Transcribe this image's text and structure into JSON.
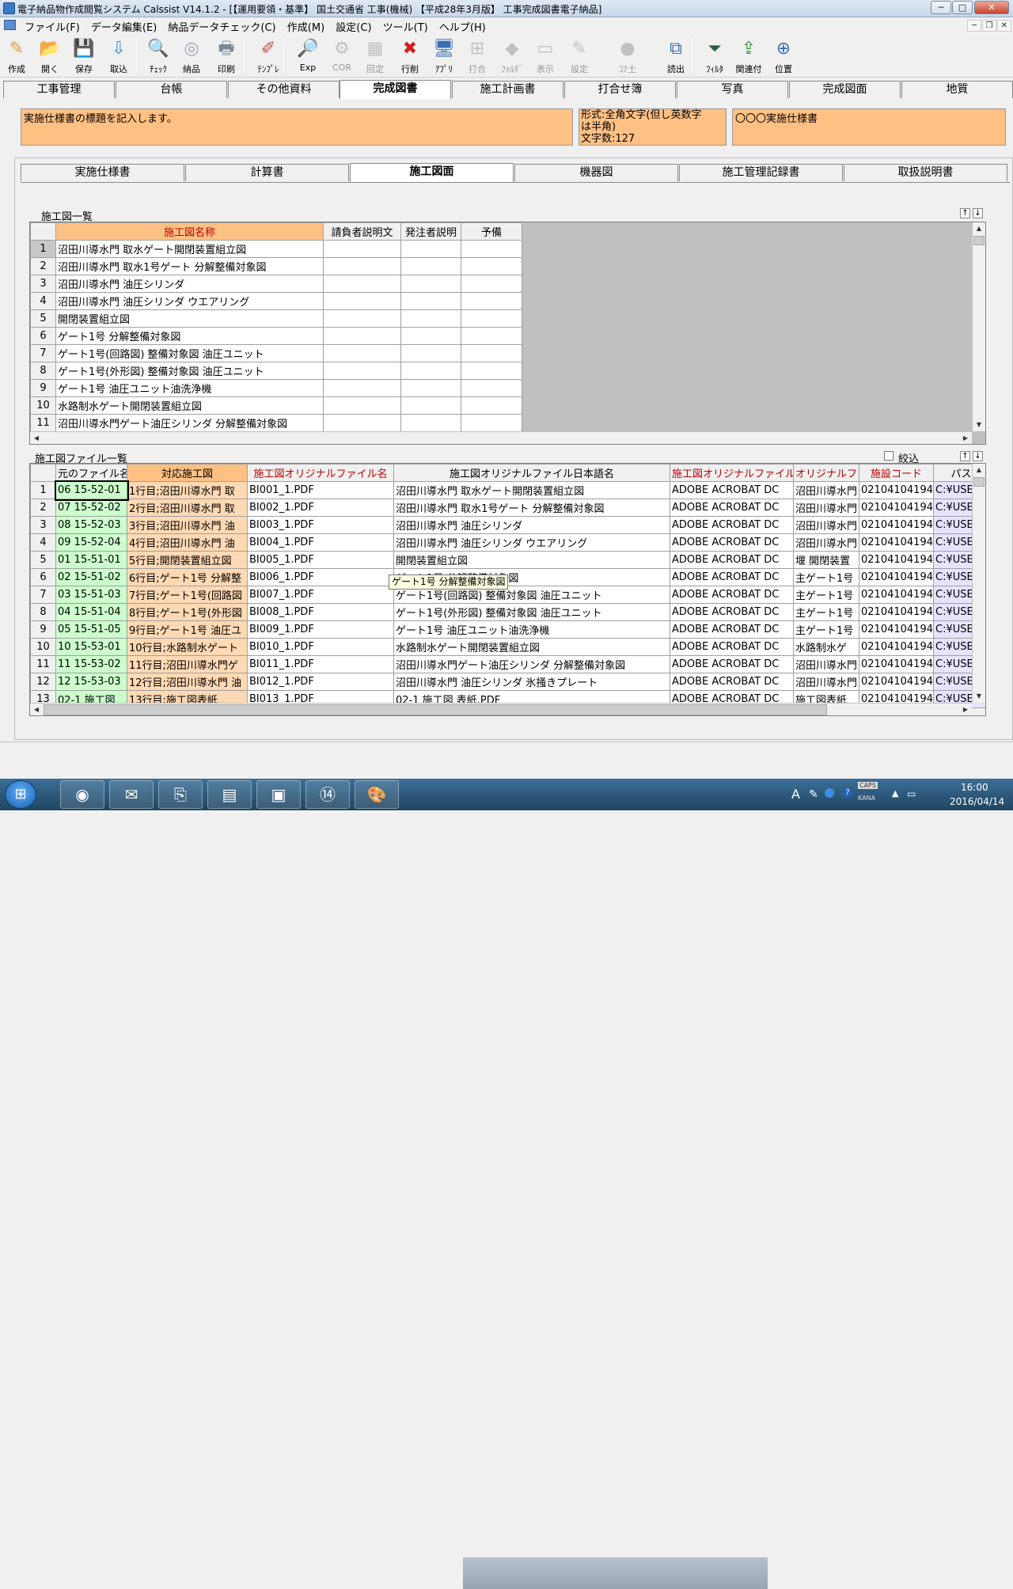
{
  "window": {
    "title": "電子納品物作成閲覧システム Calssist V14.1.2 - [【運用要領・基準】 国土交通省 工事(機械) 【平成28年3月版】 工事完成図書電子納品]",
    "minimize": "─",
    "maximize": "□",
    "close": "✕"
  },
  "menubar": {
    "items": [
      "ファイル(F)",
      "データ編集(E)",
      "納品データチェック(C)",
      "作成(M)",
      "設定(C)",
      "ツール(T)",
      "ヘルプ(H)"
    ],
    "mdi_min": "─",
    "mdi_restore": "❐",
    "mdi_close": "✕"
  },
  "toolbar": {
    "buttons": [
      {
        "label": "作成",
        "icon": "create-icon",
        "glyph": "✎",
        "color": "#d9a441"
      },
      {
        "label": "開く",
        "icon": "open-folder-icon",
        "glyph": "📂",
        "color": "#f4c64d"
      },
      {
        "label": "保存",
        "icon": "save-icon",
        "glyph": "💾",
        "color": "#2a3f7a"
      },
      {
        "label": "取込",
        "icon": "import-icon",
        "glyph": "⇩",
        "color": "#3c8fd6"
      },
      {
        "label": "ﾁｪｯｸ",
        "icon": "check-icon",
        "glyph": "🔍",
        "color": "#6aa8e0"
      },
      {
        "label": "納品",
        "icon": "disc-icon",
        "glyph": "◎",
        "color": "#9aa7b8"
      },
      {
        "label": "印刷",
        "icon": "print-icon",
        "glyph": "🖶",
        "color": "#7d8794"
      },
      {
        "label": "ﾃﾝﾌﾟﾚ",
        "icon": "template-icon",
        "glyph": "✐",
        "color": "#c94c4c"
      },
      {
        "label": "Exp",
        "icon": "explorer-icon",
        "glyph": "🔎",
        "color": "#e8c24a"
      },
      {
        "label": "COR",
        "icon": "cor-icon",
        "glyph": "⚙",
        "color": "#8a8a8a",
        "disabled": true
      },
      {
        "label": "回定",
        "icon": "fixed-icon",
        "glyph": "▦",
        "color": "#8a8a8a",
        "disabled": true
      },
      {
        "label": "行削",
        "icon": "delete-row-icon",
        "glyph": "✖",
        "color": "#d02020"
      },
      {
        "label": "ｱﾌﾟﾘ",
        "icon": "app-icon",
        "glyph": "🖥",
        "color": "#3a6fb5"
      },
      {
        "label": "打合",
        "icon": "meeting-icon",
        "glyph": "⊞",
        "color": "#8a8a8a",
        "disabled": true
      },
      {
        "label": "ﾌｫﾙﾀﾞ",
        "icon": "folder-icon",
        "glyph": "◆",
        "color": "#8a8a8a",
        "disabled": true
      },
      {
        "label": "表示",
        "icon": "view-icon",
        "glyph": "▭",
        "color": "#8a8a8a",
        "disabled": true
      },
      {
        "label": "設定",
        "icon": "settings-icon",
        "glyph": "✎",
        "color": "#8a8a8a",
        "disabled": true
      },
      {
        "label": "ｺｱ土",
        "icon": "core-icon",
        "glyph": "●",
        "color": "#8a8a8a",
        "disabled": true
      },
      {
        "label": "読出",
        "icon": "read-icon",
        "glyph": "⧉",
        "color": "#3a6fb5"
      },
      {
        "label": "ﾌｨﾙﾀ",
        "icon": "filter-icon",
        "glyph": "⏷",
        "color": "#2a6040"
      },
      {
        "label": "関連付",
        "icon": "link-icon",
        "glyph": "⇪",
        "color": "#2f8f2f"
      },
      {
        "label": "位置",
        "icon": "position-icon",
        "glyph": "⊕",
        "color": "#3a6fb5"
      }
    ]
  },
  "main_tabs": [
    "工事管理",
    "台帳",
    "その他資料",
    "完成図書",
    "施工計画書",
    "打合せ簿",
    "写真",
    "完成図面",
    "地質"
  ],
  "main_tab_active": "完成図書",
  "info": {
    "help": "実施仕様書の標題を記入します。",
    "format_line1": "形式:全角文字(但し英数字",
    "format_line2": "は半角)",
    "format_line3": "文字数:127",
    "value": "〇〇〇実施仕様書"
  },
  "sub_tabs": [
    "実施仕様書",
    "計算書",
    "施工図面",
    "機器図",
    "施工管理記録書",
    "取扱説明書"
  ],
  "sub_tab_active": "施工図面",
  "drawing_list": {
    "label": "施工図一覧",
    "columns": [
      "施工図名称",
      "請負者説明文",
      "発注者説明",
      "予備"
    ],
    "rows": [
      "沼田川導水門 取水ゲート開閉装置組立図",
      "沼田川導水門 取水1号ゲート 分解整備対象図",
      "沼田川導水門 油圧シリンダ",
      "沼田川導水門 油圧シリンダ ウエアリング",
      "開閉装置組立図",
      "ゲート1号 分解整備対象図",
      "ゲート1号(回路図) 整備対象図 油圧ユニット",
      "ゲート1号(外形図) 整備対象図 油圧ユニット",
      "ゲート1号 油圧ユニット油洗浄機",
      "水路制水ゲート開閉装置組立図",
      "沼田川導水門ゲート油圧シリンダ 分解整備対象図"
    ],
    "sort_up": "↑",
    "sort_down": "↓"
  },
  "file_list": {
    "label": "施工図ファイル一覧",
    "filter_label": "絞込",
    "columns": [
      "元のファイル名",
      "対応施工図",
      "施工図オリジナルファイル名",
      "施工図オリジナルファイル日本語名",
      "施工図オリジナルファイル",
      "オリジナルフ",
      "施設コード",
      "パス"
    ],
    "rows": [
      [
        "06 15-52-01",
        "1行目;沼田川導水門 取",
        "BI001_1.PDF",
        "沼田川導水門 取水ゲート開閉装置組立図",
        "ADOBE ACROBAT DC",
        "沼田川導水門",
        "02104104194",
        "C:¥USEI"
      ],
      [
        "07 15-52-02",
        "2行目;沼田川導水門 取",
        "BI002_1.PDF",
        "沼田川導水門 取水1号ゲート 分解整備対象図",
        "ADOBE ACROBAT DC",
        "沼田川導水門",
        "02104104194",
        "C:¥USEI"
      ],
      [
        "08 15-52-03",
        "3行目;沼田川導水門 油",
        "BI003_1.PDF",
        "沼田川導水門 油圧シリンダ",
        "ADOBE ACROBAT DC",
        "沼田川導水門",
        "02104104194",
        "C:¥USEI"
      ],
      [
        "09 15-52-04",
        "4行目;沼田川導水門 油",
        "BI004_1.PDF",
        "沼田川導水門 油圧シリンダ ウエアリング",
        "ADOBE ACROBAT DC",
        "沼田川導水門",
        "02104104194",
        "C:¥USEI"
      ],
      [
        "01 15-51-01",
        "5行目;開閉装置組立図",
        "BI005_1.PDF",
        "開閉装置組立図",
        "ADOBE ACROBAT DC",
        "堰 開閉装置",
        "02104104194",
        "C:¥USEI"
      ],
      [
        "02 15-51-02",
        "6行目;ゲート1号 分解整",
        "BI006_1.PDF",
        "ゲート1号 分解整備対象図",
        "ADOBE ACROBAT DC",
        "主ゲート1号",
        "02104104194",
        "C:¥USEI"
      ],
      [
        "03 15-51-03",
        "7行目;ゲート1号(回路図",
        "BI007_1.PDF",
        "ゲート1号(回路図) 整備対象図 油圧ユニット",
        "ADOBE ACROBAT DC",
        "主ゲート1号",
        "02104104194",
        "C:¥USEI"
      ],
      [
        "04 15-51-04",
        "8行目;ゲート1号(外形図",
        "BI008_1.PDF",
        "ゲート1号(外形図) 整備対象図 油圧ユニット",
        "ADOBE ACROBAT DC",
        "主ゲート1号",
        "02104104194",
        "C:¥USEI"
      ],
      [
        "05 15-51-05",
        "9行目;ゲート1号 油圧ユ",
        "BI009_1.PDF",
        "ゲート1号 油圧ユニット油洗浄機",
        "ADOBE ACROBAT DC",
        "主ゲート1号",
        "02104104194",
        "C:¥USEI"
      ],
      [
        "10 15-53-01",
        "10行目;水路制水ゲート",
        "BI010_1.PDF",
        "水路制水ゲート開閉装置組立図",
        "ADOBE ACROBAT DC",
        "水路制水ゲ",
        "02104104194",
        "C:¥USEI"
      ],
      [
        "11 15-53-02",
        "11行目;沼田川導水門ゲ",
        "BI011_1.PDF",
        "沼田川導水門ゲート油圧シリンダ 分解整備対象図",
        "ADOBE ACROBAT DC",
        "沼田川導水門",
        "02104104194",
        "C:¥USEI"
      ],
      [
        "12 15-53-03",
        "12行目;沼田川導水門 油",
        "BI012_1.PDF",
        "沼田川導水門 油圧シリンダ 氷掻きプレート",
        "ADOBE ACROBAT DC",
        "沼田川導水門",
        "02104104194",
        "C:¥USEI"
      ],
      [
        "02-1 施工図",
        "13行目;施工図表紙",
        "BI013_1.PDF",
        "02-1 施工図 表紙.PDF",
        "ADOBE ACROBAT DC",
        "施工図表紙",
        "02104104194",
        "C:¥USEI"
      ]
    ]
  },
  "tooltip": "ゲート1号 分解整備対象図",
  "taskbar": {
    "start": "⊞",
    "apps": [
      {
        "name": "chrome-icon",
        "glyph": "◉"
      },
      {
        "name": "mail-icon",
        "glyph": "✉"
      },
      {
        "name": "pdf-icon",
        "glyph": "⎘"
      },
      {
        "name": "calssist-icon",
        "glyph": "▤"
      },
      {
        "name": "window-icon",
        "glyph": "▣"
      },
      {
        "name": "badge-app-icon",
        "glyph": "⑭"
      },
      {
        "name": "paint-icon",
        "glyph": "🎨"
      }
    ],
    "tray": {
      "ime": "A",
      "caps": "CAPS",
      "kana": "KANA",
      "time": "16:00",
      "date": "2016/04/14"
    }
  }
}
